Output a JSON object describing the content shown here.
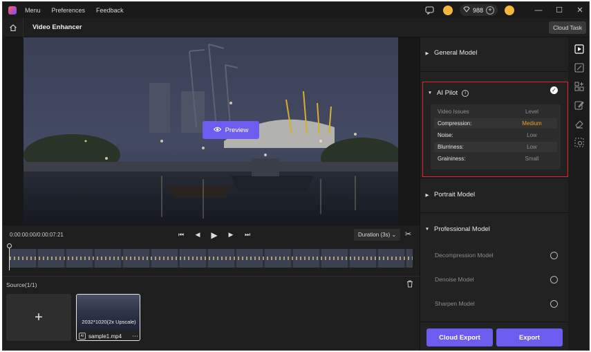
{
  "titlebar": {
    "menu": [
      "Menu",
      "Preferences",
      "Feedback"
    ],
    "credits": "988"
  },
  "header": {
    "title": "Video Enhancer",
    "cloud_task": "Cloud Task"
  },
  "preview": {
    "button_label": "Preview",
    "timecode": "0:00:00:00/0:00:07:21",
    "duration_label": "Duration (3s)"
  },
  "source": {
    "label": "Source(1/1)",
    "clip": {
      "resolution": "2032*1020(2x Upscale)",
      "name": "sample1.mp4",
      "ai_badge": "AI"
    }
  },
  "panel": {
    "general_model": "General Model",
    "ai_pilot": {
      "title": "AI Pilot",
      "header": {
        "issue": "Video Issues",
        "level": "Level"
      },
      "rows": [
        {
          "issue": "Compression:",
          "level": "Medium"
        },
        {
          "issue": "Noise:",
          "level": "Low"
        },
        {
          "issue": "Blurriness:",
          "level": "Low"
        },
        {
          "issue": "Graininess:",
          "level": "Small"
        }
      ]
    },
    "portrait_model": "Portrait Model",
    "professional_model": {
      "title": "Professional Model",
      "items": [
        "Decompression Model",
        "Denoise Model",
        "Sharpen Model"
      ]
    },
    "cloud_export": "Cloud Export",
    "export": "Export"
  },
  "colors": {
    "accent": "#6d5cf0",
    "highlight": "#f0a020",
    "ai_box_border": "#e0262e"
  }
}
